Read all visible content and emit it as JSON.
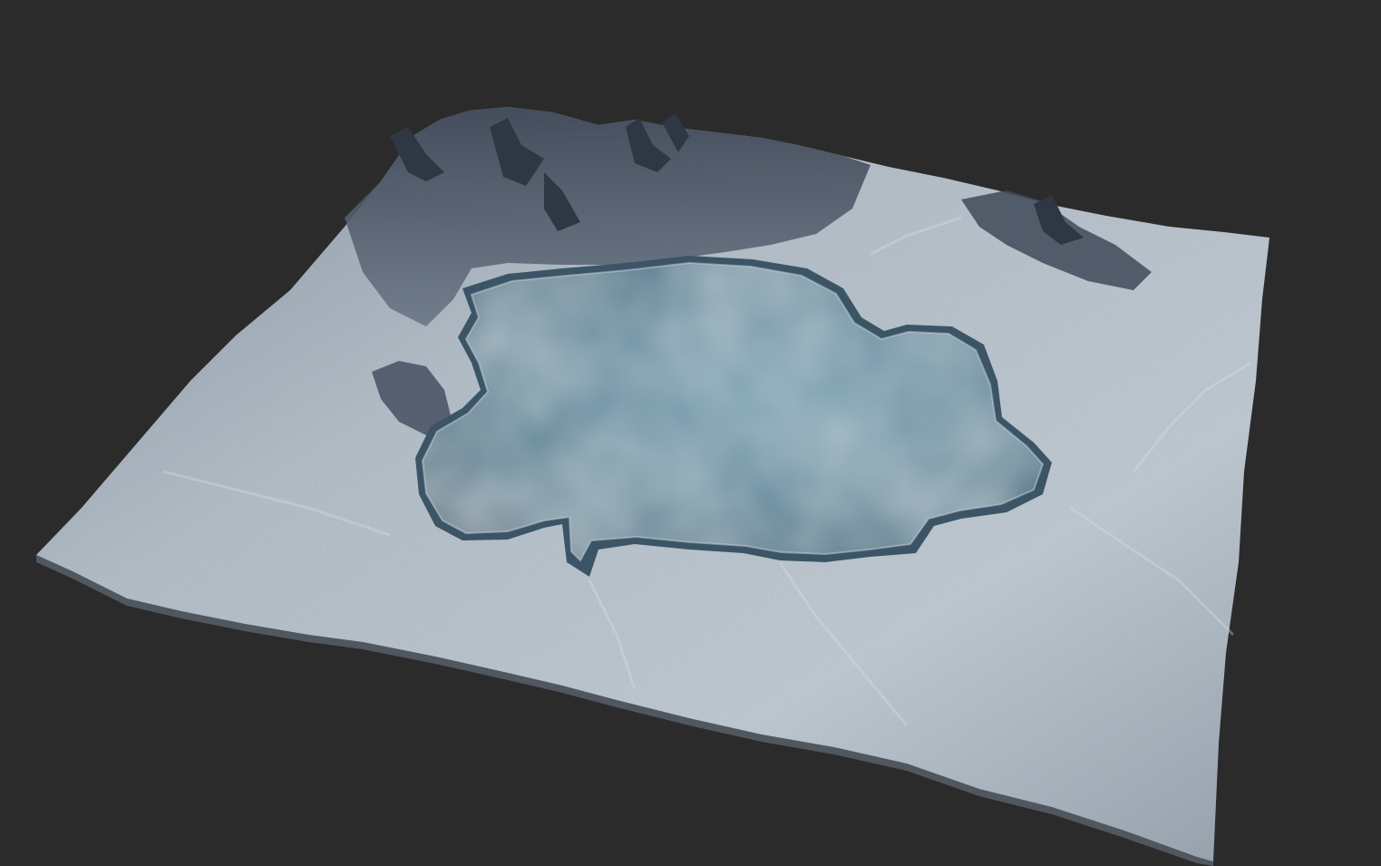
{
  "scene": {
    "description_visible": "",
    "colors": {
      "background": "#2b2b2b",
      "terrain_light": "#c9d3dc",
      "terrain_mid": "#9aa7b4",
      "terrain_dark": "#4b5563",
      "ridge_dark": "#2d3440",
      "water_light": "#a9c3cf",
      "water_mid": "#7ea0b0",
      "water_dark": "#4e6f80"
    }
  }
}
